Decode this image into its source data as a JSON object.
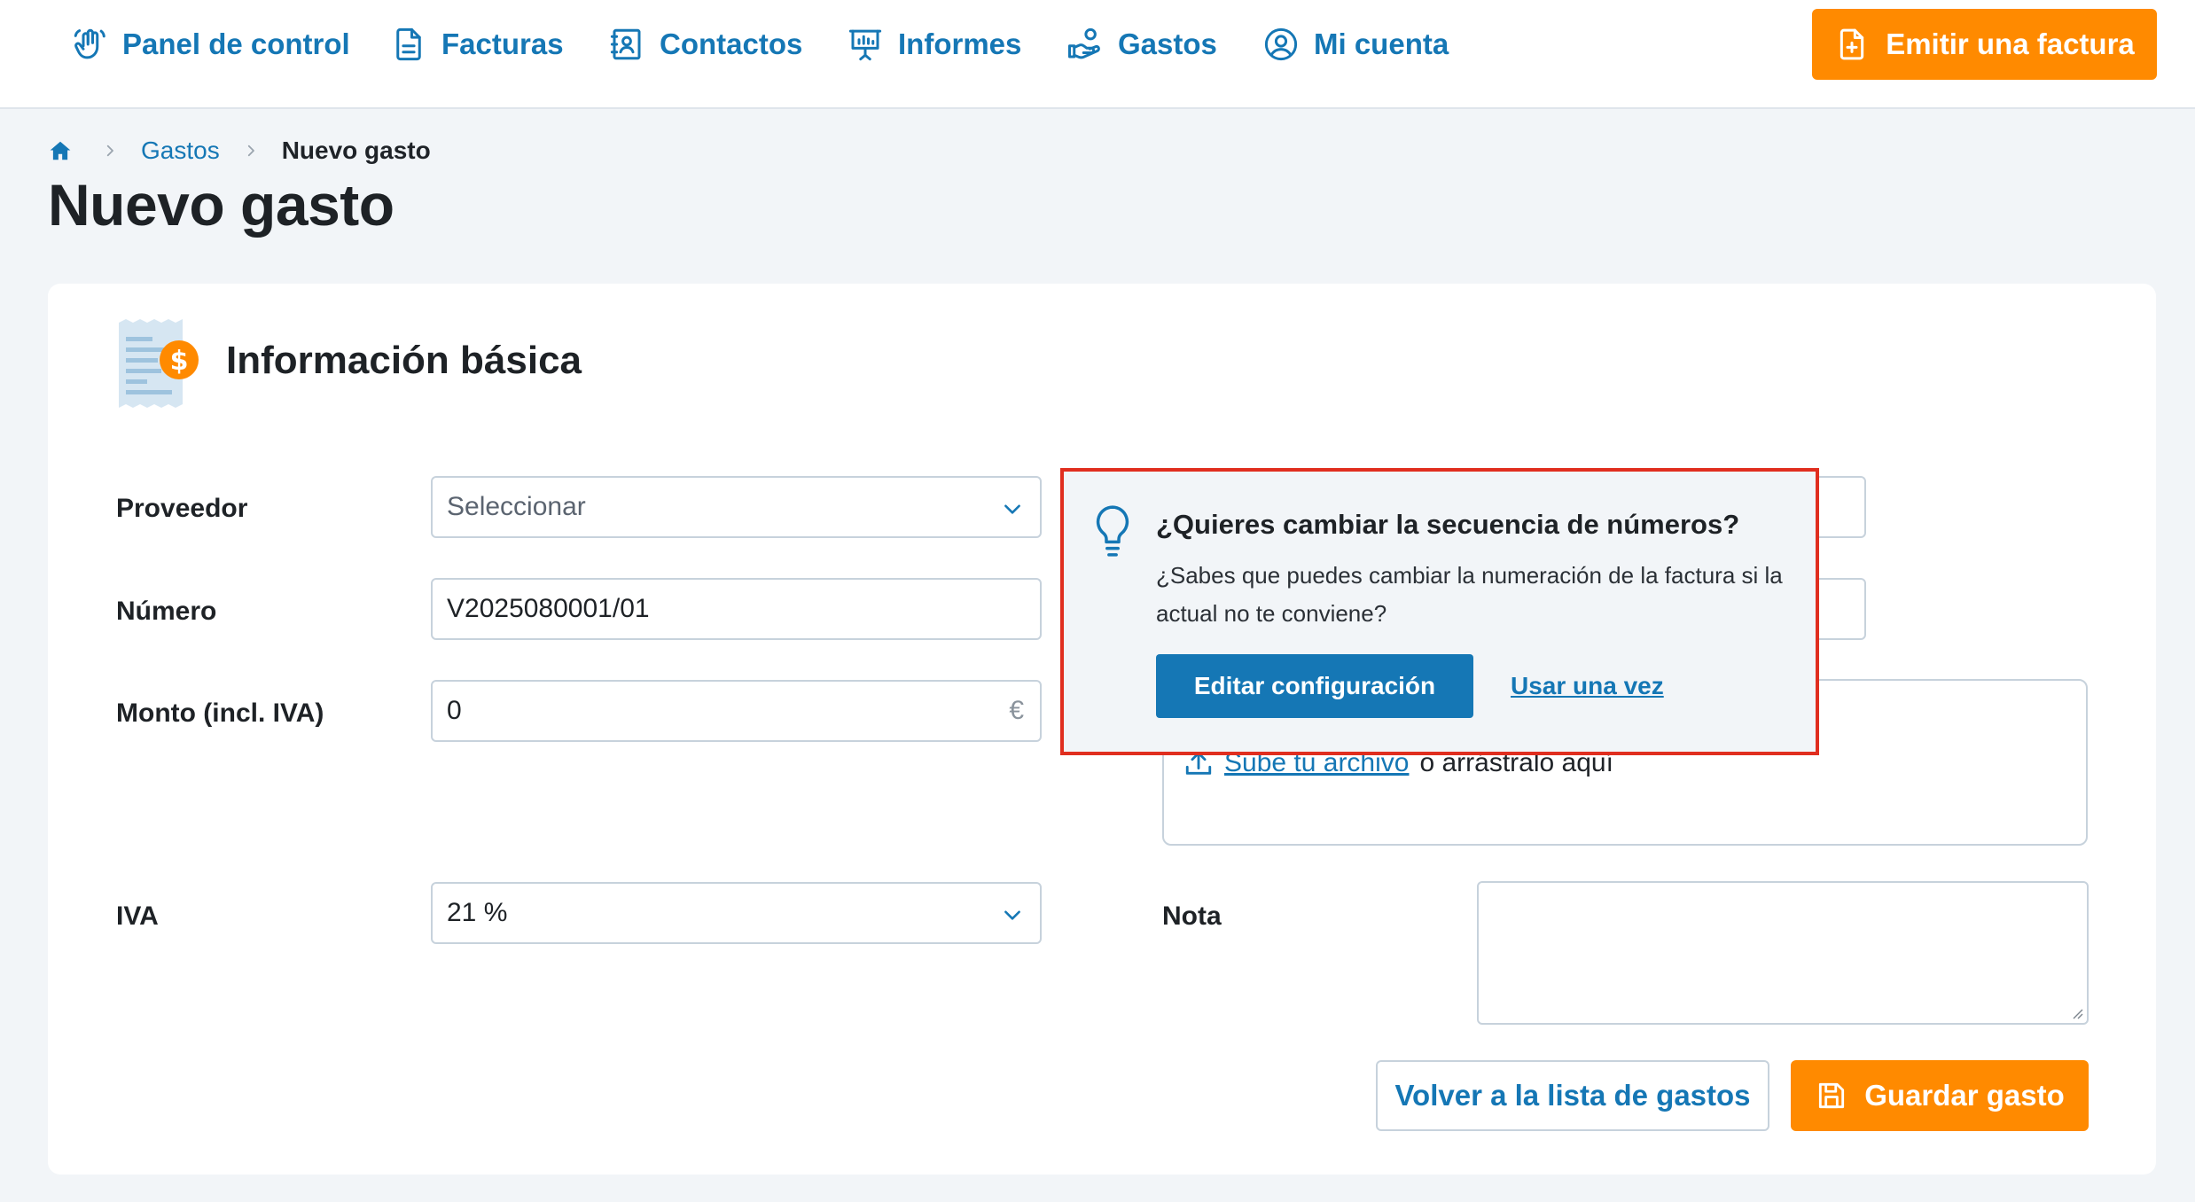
{
  "nav": {
    "items": [
      {
        "label": "Panel de control",
        "icon": "hand-wave-icon"
      },
      {
        "label": "Facturas",
        "icon": "document-icon"
      },
      {
        "label": "Contactos",
        "icon": "contact-book-icon"
      },
      {
        "label": "Informes",
        "icon": "presentation-chart-icon"
      },
      {
        "label": "Gastos",
        "icon": "hand-coin-icon"
      },
      {
        "label": "Mi cuenta",
        "icon": "user-circle-icon"
      }
    ],
    "emit_label": "Emitir una factura"
  },
  "breadcrumb": {
    "parent": "Gastos",
    "current": "Nuevo gasto"
  },
  "page": {
    "title": "Nuevo gasto"
  },
  "section": {
    "title": "Información básica"
  },
  "form": {
    "proveedor": {
      "label": "Proveedor",
      "placeholder": "Seleccionar"
    },
    "numero": {
      "label": "Número",
      "value": "V2025080001/01"
    },
    "monto": {
      "label": "Monto (incl. IVA)",
      "value": "0",
      "suffix": "€"
    },
    "iva": {
      "label": "IVA",
      "value": "21 %"
    },
    "upload": {
      "link": "Sube tu archivo",
      "rest": "o arrástralo aquí"
    },
    "nota": {
      "label": "Nota"
    }
  },
  "actions": {
    "back_label": "Volver a la lista de gastos",
    "save_label": "Guardar gasto"
  },
  "popover": {
    "title": "¿Quieres cambiar la secuencia de números?",
    "body": "¿Sabes que puedes cambiar la numeración de la factura si la actual no te conviene?",
    "edit_label": "Editar configuración",
    "once_label": "Usar una vez"
  },
  "colors": {
    "accent": "#1577b5",
    "brand_orange": "#ff8a00",
    "highlight_border": "#e02e1f",
    "background": "#f2f5f8"
  }
}
